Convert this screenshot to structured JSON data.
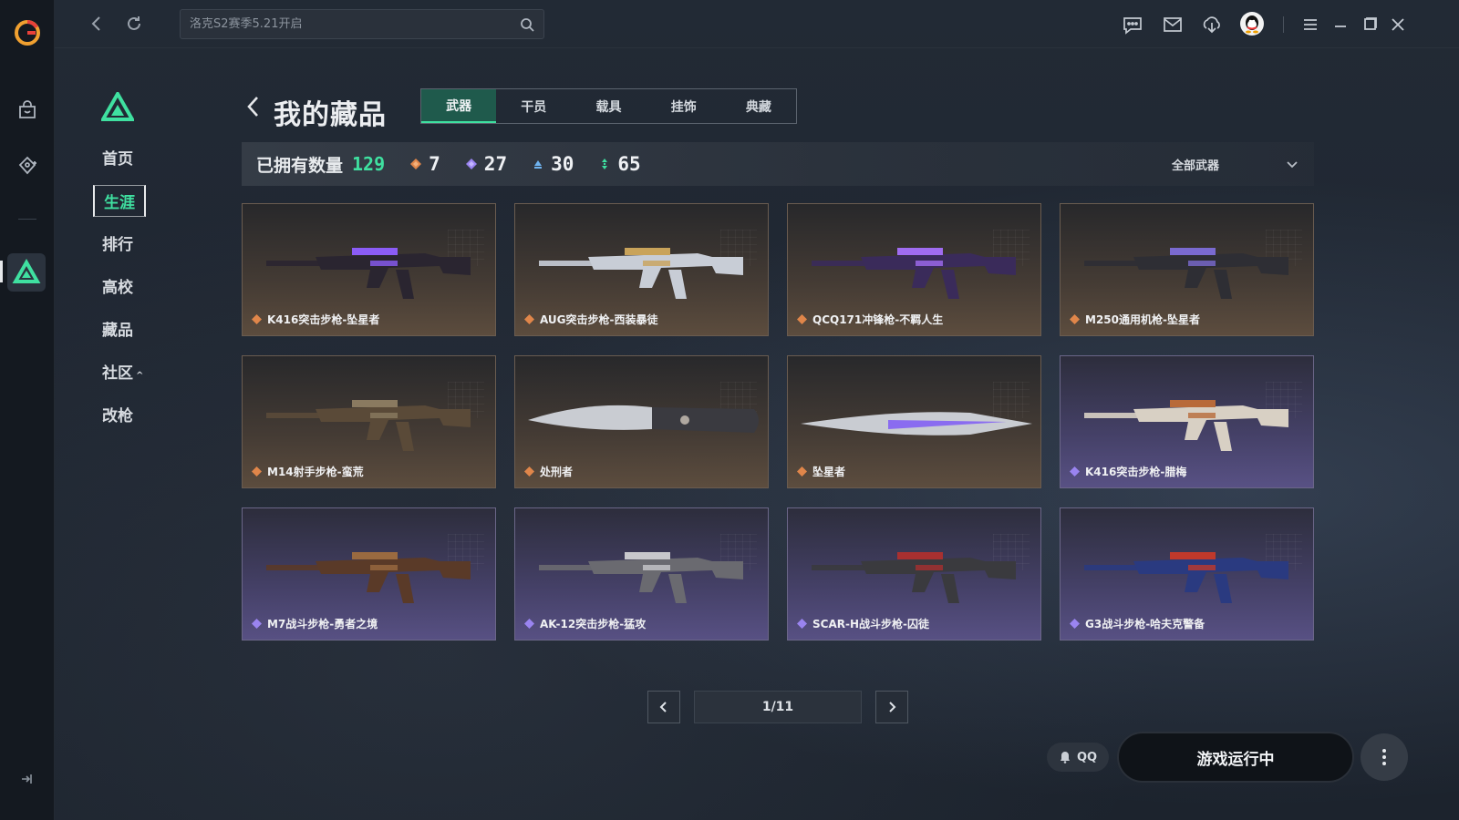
{
  "colors": {
    "accent": "#3fe0a0",
    "rarity_orange": "#e0864a",
    "rarity_purple": "#9a84f0",
    "rarity_blue": "#6fb3f0",
    "rarity_green": "#3fe0a0",
    "run_button_bg": "#0f1318"
  },
  "topbar": {
    "search_placeholder": "洛克S2赛季5.21开启",
    "icons": [
      "back-icon",
      "refresh-icon",
      "search-icon",
      "chat-icon",
      "mail-icon",
      "download-icon",
      "qq-avatar-icon",
      "menu-icon",
      "minimize-icon",
      "maximize-icon",
      "close-icon"
    ]
  },
  "sidebar": {
    "items": [
      {
        "label": "首页"
      },
      {
        "label": "生涯"
      },
      {
        "label": "排行"
      },
      {
        "label": "高校"
      },
      {
        "label": "藏品"
      },
      {
        "label": "社区"
      },
      {
        "label": "改枪"
      }
    ],
    "active_index": 1
  },
  "header": {
    "title": "我的藏品",
    "tabs": [
      {
        "label": "武器"
      },
      {
        "label": "干员"
      },
      {
        "label": "载具"
      },
      {
        "label": "挂饰"
      },
      {
        "label": "典藏"
      }
    ],
    "active_tab": 0
  },
  "stats": {
    "owned_label": "已拥有数量",
    "owned_total": "129",
    "rarities": [
      {
        "color": "#e0864a",
        "count": "7"
      },
      {
        "color": "#9a84f0",
        "count": "27"
      },
      {
        "color": "#6fb3f0",
        "count": "30"
      },
      {
        "color": "#3fe0a0",
        "count": "65"
      }
    ],
    "filter_label": "全部武器"
  },
  "items": [
    {
      "name": "K416突击步枪-坠星者",
      "rarity": "orange"
    },
    {
      "name": "AUG突击步枪-西装暴徒",
      "rarity": "orange"
    },
    {
      "name": "QCQ171冲锋枪-不羁人生",
      "rarity": "orange"
    },
    {
      "name": "M250通用机枪-坠星者",
      "rarity": "orange"
    },
    {
      "name": "M14射手步枪-蛮荒",
      "rarity": "orange"
    },
    {
      "name": "处刑者",
      "rarity": "orange"
    },
    {
      "name": "坠星者",
      "rarity": "orange"
    },
    {
      "name": "K416突击步枪-腊梅",
      "rarity": "purple"
    },
    {
      "name": "M7战斗步枪-勇者之境",
      "rarity": "purple"
    },
    {
      "name": "AK-12突击步枪-猛攻",
      "rarity": "purple"
    },
    {
      "name": "SCAR-H战斗步枪-囚徒",
      "rarity": "purple"
    },
    {
      "name": "G3战斗步枪-哈夫克警备",
      "rarity": "purple"
    }
  ],
  "pagination": {
    "page_text": "1/11"
  },
  "bottom": {
    "qq_label": "QQ",
    "run_label": "游戏运行中"
  }
}
